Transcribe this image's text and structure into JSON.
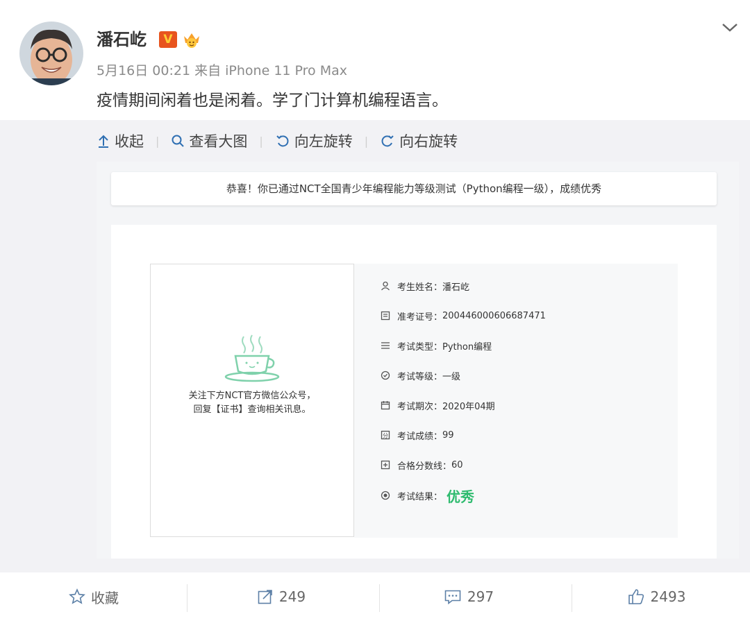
{
  "post": {
    "author": "潘石屹",
    "verified_badge": "V",
    "meta": "5月16日 00:21 来自 iPhone 11 Pro Max",
    "text": "疫情期间闲着也是闲着。学了门计算机编程语言。"
  },
  "toolbar": {
    "collapse": "收起",
    "view_large": "查看大图",
    "rotate_left": "向左旋转",
    "rotate_right": "向右旋转"
  },
  "screenshot": {
    "banner": "恭喜！你已通过NCT全国青少年编程能力等级测试（Python编程一级），成绩优秀",
    "qr_note_line1": "关注下方NCT官方微信公众号，",
    "qr_note_line2": "回复【证书】查询相关讯息。",
    "fields": [
      {
        "label": "考生姓名：",
        "value": "潘石屹",
        "icon": "person-icon"
      },
      {
        "label": "准考证号：",
        "value": "200446000606687471",
        "icon": "id-card-icon"
      },
      {
        "label": "考试类型：",
        "value": "Python编程",
        "icon": "list-icon"
      },
      {
        "label": "考试等级：",
        "value": "一级",
        "icon": "badge-icon"
      },
      {
        "label": "考试期次：",
        "value": "2020年04期",
        "icon": "calendar-icon"
      },
      {
        "label": "考试成绩：",
        "value": "99",
        "icon": "score-icon"
      },
      {
        "label": "合格分数线：",
        "value": "60",
        "icon": "score-line-icon"
      },
      {
        "label": "考试结果：",
        "value": "优秀",
        "icon": "result-icon"
      }
    ],
    "accent": "#2fbb6f"
  },
  "actions": {
    "favorite": "收藏",
    "repost_count": "249",
    "comment_count": "297",
    "like_count": "2493"
  },
  "colors": {
    "badge_orange": "#e8541e",
    "panel_bg": "#f2f2f5",
    "meta_gray": "#8a8a8a"
  }
}
